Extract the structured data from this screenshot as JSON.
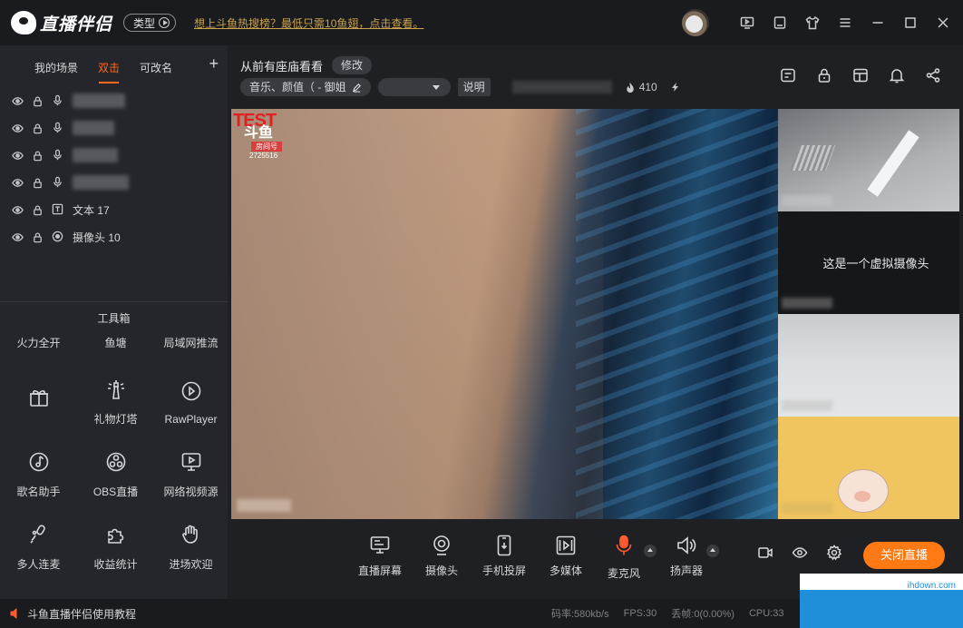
{
  "titlebar": {
    "app_name": "直播伴侣",
    "type_button": "类型",
    "promo_text": "想上斗鱼热搜榜？最低只需10鱼翅，点击查看。"
  },
  "scenes": {
    "tabs": [
      "我的场景",
      "双击",
      "可改名"
    ],
    "active_tab": 1
  },
  "sources": [
    {
      "type": "mic-icon",
      "name": ""
    },
    {
      "type": "mic-icon",
      "name": ""
    },
    {
      "type": "mic-icon",
      "name": ""
    },
    {
      "type": "mic-icon",
      "name": ""
    },
    {
      "type": "text-icon",
      "name": "文本 17"
    },
    {
      "type": "camera-icon",
      "name": "摄像头 10"
    }
  ],
  "toolbox": {
    "title": "工具箱",
    "top_row": [
      "火力全开",
      "鱼塘",
      "局域网推流"
    ],
    "items": [
      {
        "icon": "gift-icon",
        "label": ""
      },
      {
        "icon": "lighthouse-icon",
        "label": "礼物灯塔"
      },
      {
        "icon": "play-circle-icon",
        "label": "RawPlayer"
      },
      {
        "icon": "music-note-icon",
        "label": "歌名助手"
      },
      {
        "icon": "obs-icon",
        "label": "OBS直播"
      },
      {
        "icon": "web-video-icon",
        "label": "网络视频源"
      },
      {
        "icon": "multi-mic-icon",
        "label": "多人连麦"
      },
      {
        "icon": "puzzle-icon",
        "label": "收益统计"
      },
      {
        "icon": "wave-hand-icon",
        "label": "进场欢迎"
      }
    ]
  },
  "room": {
    "title": "从前有座庙看看",
    "edit_label": "修改",
    "category": "音乐、颜值（ - 御姐",
    "explain_label": "说明",
    "heat_value": "410"
  },
  "preview": {
    "watermark_test": "TEST",
    "watermark_brand": "斗鱼",
    "watermark_tag": "房间号",
    "watermark_room": "2725516",
    "virtual_camera_text": "这是一个虚拟摄像头"
  },
  "bottom_tools": [
    {
      "icon": "screen-icon",
      "label": "直播屏幕"
    },
    {
      "icon": "webcam-icon",
      "label": "摄像头"
    },
    {
      "icon": "phone-cast-icon",
      "label": "手机投屏"
    },
    {
      "icon": "media-icon",
      "label": "多媒体"
    },
    {
      "icon": "mic-icon",
      "label": "麦克风"
    },
    {
      "icon": "speaker-icon",
      "label": "扬声器"
    }
  ],
  "stop_button": "关闭直播",
  "statusbar": {
    "tutorial": "斗鱼直播伴侣使用教程",
    "bitrate": "码率:580kb/s",
    "fps": "FPS:30",
    "dropped": "丢帧:0(0.00%)",
    "cpu": "CPU:33"
  },
  "watermark_site": "ihdown.com"
}
